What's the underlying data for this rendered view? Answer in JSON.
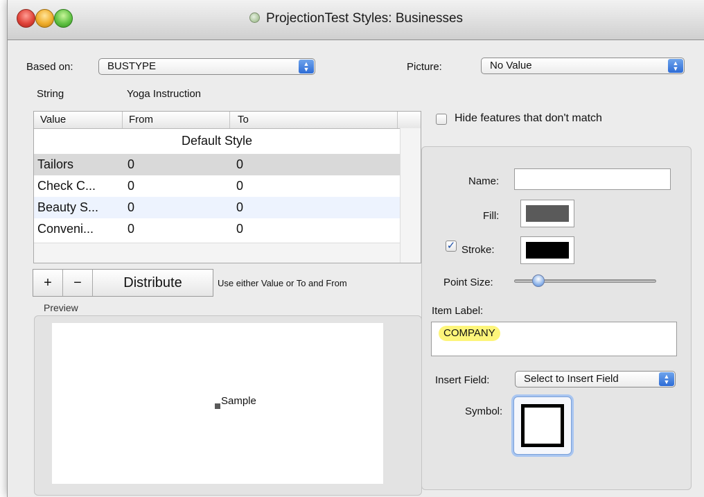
{
  "window": {
    "title": "ProjectionTest Styles: Businesses"
  },
  "based_on": {
    "label": "Based on:",
    "value": "BUSTYPE"
  },
  "picture": {
    "label": "Picture:",
    "value": "No Value"
  },
  "string_row": {
    "label": "String",
    "value": "Yoga Instruction"
  },
  "table": {
    "columns": [
      "Value",
      "From",
      "To"
    ],
    "default_row": "Default Style",
    "rows": [
      {
        "value": "Tailors",
        "from": "0",
        "to": "0"
      },
      {
        "value": "Check C...",
        "from": "0",
        "to": "0"
      },
      {
        "value": "Beauty S...",
        "from": "0",
        "to": "0"
      },
      {
        "value": "Conveni...",
        "from": "0",
        "to": "0"
      }
    ]
  },
  "buttons": {
    "add": "+",
    "remove": "−",
    "distribute": "Distribute"
  },
  "hint": "Use either Value or To and From",
  "preview": {
    "label": "Preview",
    "sample": "Sample"
  },
  "hide_features": {
    "label": "Hide features that don't match",
    "checked": false
  },
  "style": {
    "name_label": "Name:",
    "name_value": "",
    "fill_label": "Fill:",
    "fill_color": "#5a5a5a",
    "stroke_label": "Stroke:",
    "stroke_checked": true,
    "stroke_color": "#000000",
    "point_size_label": "Point Size:",
    "point_size_fraction": 0.15,
    "item_label_label": "Item Label:",
    "item_label_token": "COMPANY",
    "insert_field_label": "Insert Field:",
    "insert_field_value": "Select to Insert Field",
    "symbol_label": "Symbol:"
  },
  "colors": {
    "accent": "#2d6cd6",
    "row_selected": "#d9d9d9",
    "row_alt": "#edf3fe",
    "token_highlight": "#fdf57a"
  }
}
